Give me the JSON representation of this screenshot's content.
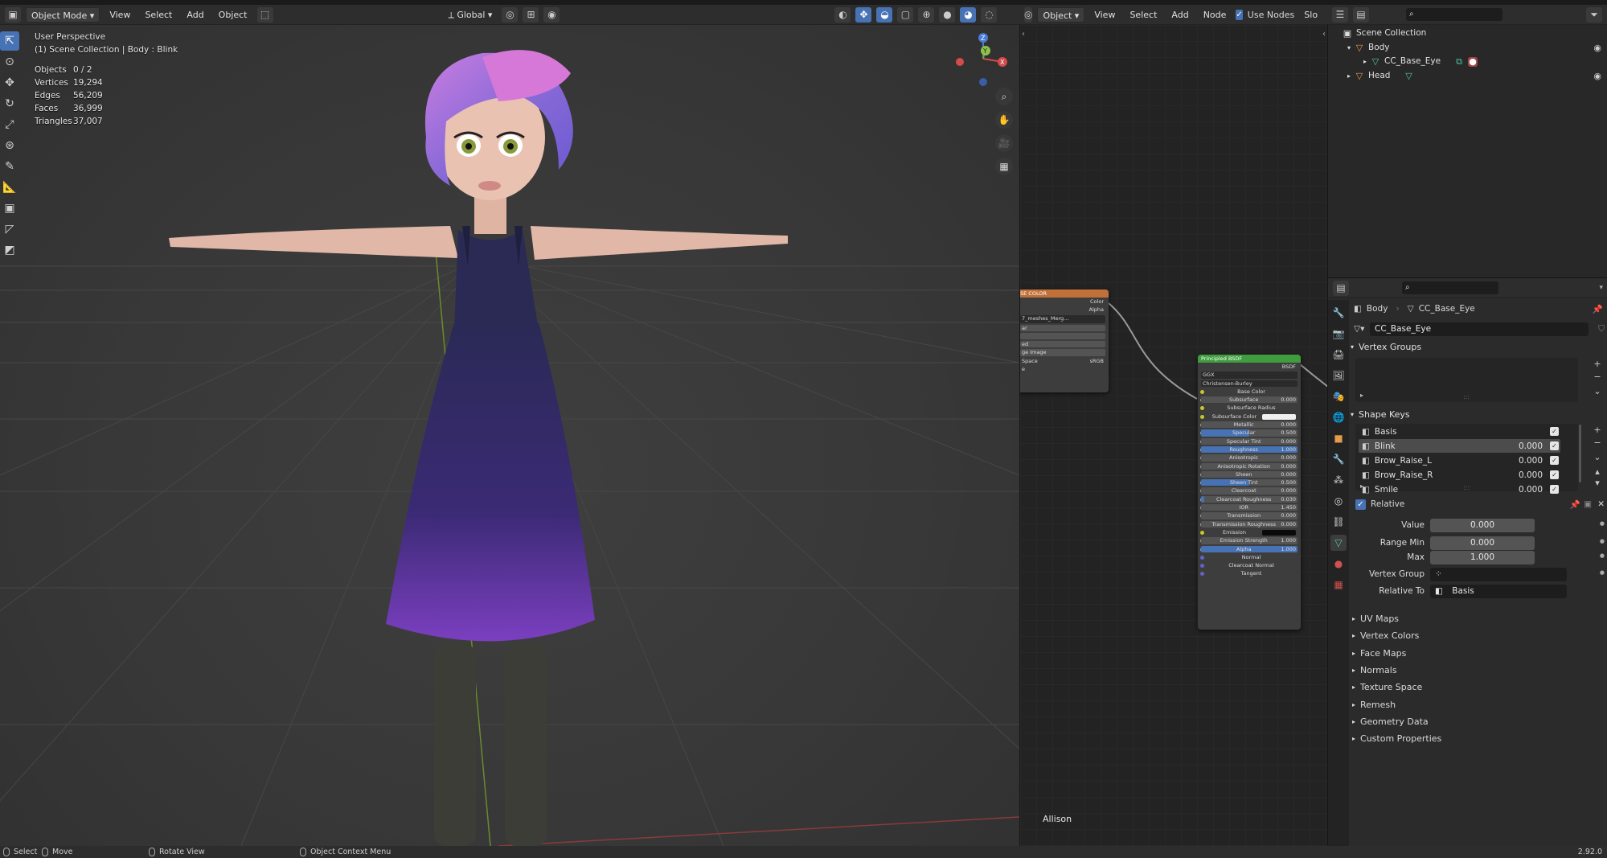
{
  "viewport_header": {
    "mode": "Object Mode",
    "menus": [
      "View",
      "Select",
      "Add",
      "Object"
    ],
    "orientation": "Global"
  },
  "viewport_overlay": {
    "view_name": "User Perspective",
    "collection_path": "(1) Scene Collection | Body : Blink",
    "stats": [
      {
        "label": "Objects",
        "value": "0 / 2"
      },
      {
        "label": "Vertices",
        "value": "19,294"
      },
      {
        "label": "Edges",
        "value": "56,209"
      },
      {
        "label": "Faces",
        "value": "36,999"
      },
      {
        "label": "Triangles",
        "value": "37,007"
      }
    ],
    "camera_name": "Allison"
  },
  "gizmo": {
    "z": "Z",
    "y": "Y",
    "x": "X"
  },
  "node_header": {
    "type": "Object",
    "menus": [
      "View",
      "Select",
      "Add",
      "Node"
    ],
    "use_nodes_label": "Use Nodes",
    "slot_label": "Slo"
  },
  "image_node": {
    "title": "SE COLOR",
    "outputs": [
      "Color",
      "Alpha"
    ],
    "image_name": "7_meshes_Merg...",
    "rows": [
      "ar",
      "",
      "ed",
      "ge Image",
      "Space",
      "e"
    ],
    "colorspace_value": "sRGB"
  },
  "bsdf_node": {
    "title": "Principled BSDF",
    "output": "BSDF",
    "dist": "GGX",
    "sss_method": "Christensen-Burley",
    "inputs": [
      {
        "name": "Base Color",
        "value": "",
        "kind": "label"
      },
      {
        "name": "Subsurface",
        "value": "0.000",
        "kind": "bar",
        "fill": 0
      },
      {
        "name": "Subsurface Radius",
        "value": "",
        "kind": "drop"
      },
      {
        "name": "Subsurface Color",
        "value": "",
        "kind": "white"
      },
      {
        "name": "Metallic",
        "value": "0.000",
        "kind": "bar",
        "fill": 0
      },
      {
        "name": "Specular",
        "value": "0.500",
        "kind": "bar",
        "fill": 0.5
      },
      {
        "name": "Specular Tint",
        "value": "0.000",
        "kind": "bar",
        "fill": 0
      },
      {
        "name": "Roughness",
        "value": "1.000",
        "kind": "bar",
        "fill": 1
      },
      {
        "name": "Anisotropic",
        "value": "0.000",
        "kind": "bar",
        "fill": 0
      },
      {
        "name": "Anisotropic Rotation",
        "value": "0.000",
        "kind": "bar",
        "fill": 0
      },
      {
        "name": "Sheen",
        "value": "0.000",
        "kind": "bar",
        "fill": 0
      },
      {
        "name": "Sheen Tint",
        "value": "0.500",
        "kind": "bar",
        "fill": 0.5
      },
      {
        "name": "Clearcoat",
        "value": "0.000",
        "kind": "bar",
        "fill": 0
      },
      {
        "name": "Clearcoat Roughness",
        "value": "0.030",
        "kind": "bar",
        "fill": 0.03
      },
      {
        "name": "IOR",
        "value": "1.450",
        "kind": "bar",
        "fill": 0
      },
      {
        "name": "Transmission",
        "value": "0.000",
        "kind": "bar",
        "fill": 0
      },
      {
        "name": "Transmission Roughness",
        "value": "0.000",
        "kind": "bar",
        "fill": 0
      },
      {
        "name": "Emission",
        "value": "",
        "kind": "black"
      },
      {
        "name": "Emission Strength",
        "value": "1.000",
        "kind": "bar",
        "fill": 0
      },
      {
        "name": "Alpha",
        "value": "1.000",
        "kind": "bar",
        "fill": 1
      },
      {
        "name": "Normal",
        "value": "",
        "kind": "label"
      },
      {
        "name": "Clearcoat Normal",
        "value": "",
        "kind": "label"
      },
      {
        "name": "Tangent",
        "value": "",
        "kind": "label"
      }
    ]
  },
  "outliner": {
    "items": [
      {
        "label": "Scene Collection",
        "depth": 0
      },
      {
        "label": "Body",
        "depth": 1
      },
      {
        "label": "CC_Base_Eye",
        "depth": 2
      },
      {
        "label": "Head",
        "depth": 1
      }
    ]
  },
  "properties": {
    "breadcrumb": [
      "Body",
      "CC_Base_Eye"
    ],
    "mesh_name": "CC_Base_Eye",
    "vertex_groups_title": "Vertex Groups",
    "shape_keys_title": "Shape Keys",
    "shape_keys": [
      {
        "name": "Basis",
        "value": ""
      },
      {
        "name": "Blink",
        "value": "0.000"
      },
      {
        "name": "Brow_Raise_L",
        "value": "0.000"
      },
      {
        "name": "Brow_Raise_R",
        "value": "0.000"
      },
      {
        "name": "Smile",
        "value": "0.000"
      }
    ],
    "relative_label": "Relative",
    "fields": [
      {
        "label": "Value",
        "value": "0.000"
      },
      {
        "label": "Range Min",
        "value": "0.000"
      },
      {
        "label": "Max",
        "value": "1.000"
      },
      {
        "label": "Vertex Group",
        "value": ""
      },
      {
        "label": "Relative To",
        "value": "Basis"
      }
    ],
    "collapsed_panels": [
      "UV Maps",
      "Vertex Colors",
      "Face Maps",
      "Normals",
      "Texture Space",
      "Remesh",
      "Geometry Data",
      "Custom Properties"
    ]
  },
  "statusbar": {
    "select": "Select",
    "move": "Move",
    "rotate": "Rotate View",
    "context": "Object Context Menu",
    "version": "2.92.0"
  },
  "colors": {
    "accent": "#4772b3",
    "node_green": "#3f9c3f",
    "image_node": "#c0713a"
  }
}
